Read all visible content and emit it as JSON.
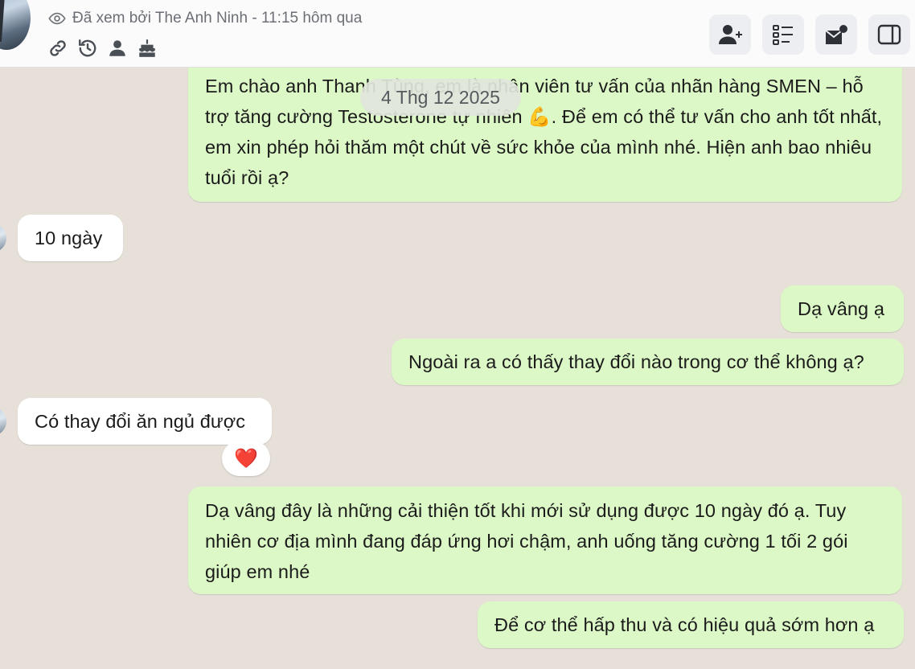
{
  "header": {
    "seen_text": "Đã xem bởi The Anh Ninh - 11:15 hôm qua",
    "meta_icons": [
      "link-icon",
      "history-icon",
      "person-icon",
      "cake-icon"
    ],
    "buttons": [
      "add-contact-icon",
      "list-icon",
      "mailbox-icon",
      "side-panel-icon"
    ]
  },
  "date_separator": "4 Thg 12 2025",
  "messages": [
    {
      "side": "out",
      "text": "Em chào anh Thanh Tùng, em là nhân viên tư vấn của nhãn hàng SMEN – hỗ trợ tăng cường Testosterone tự nhiên 💪. Để em có thể tư vấn cho anh tốt nhất, em xin phép hỏi thăm một chút về sức khỏe của mình nhé. Hiện anh bao nhiêu tuổi rồi ạ?"
    },
    {
      "side": "in",
      "text": "10 ngày"
    },
    {
      "side": "out",
      "text": "Dạ vâng ạ"
    },
    {
      "side": "out",
      "text": "Ngoài ra a có thấy thay đổi nào trong cơ thể không ạ?"
    },
    {
      "side": "in",
      "text": "Có thay đổi ăn ngủ được"
    },
    {
      "side": "out",
      "text": "Dạ vâng đây là những cải thiện tốt khi mới sử dụng được 10 ngày đó ạ. Tuy nhiên cơ địa mình đang đáp ứng hơi chậm, anh uống tăng cường 1 tối 2 gói giúp em nhé"
    },
    {
      "side": "out",
      "text": "Để cơ thể hấp thu và có hiệu quả sớm hơn ạ"
    }
  ],
  "reaction": "❤️",
  "colors": {
    "outgoing": "#dcf8c6",
    "incoming": "#ffffff",
    "background": "#e6e0d9"
  }
}
